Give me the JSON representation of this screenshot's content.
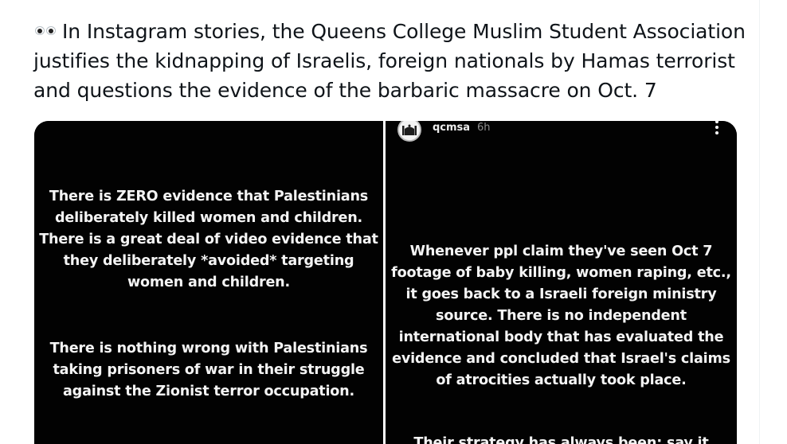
{
  "tweet": {
    "emoji": "eyes-emoji",
    "line1": "In Instagram stories, the Queens College Muslim Student Association",
    "line2": "justifies the kidnapping of Israelis, foreign nationals by Hamas terrorist",
    "line3": "and questions the evidence of the barbaric massacre on Oct. 7"
  },
  "left_story": {
    "paragraph1": "There is ZERO evidence that Palestinians deliberately killed women and children. There is a great deal of video evidence that they deliberately *avoided* targeting women and children.",
    "paragraph2": "There is nothing wrong with Palestinians taking prisoners of war in their struggle against the Zionist terror occupation."
  },
  "right_story": {
    "username": "qcmsa",
    "time": "6h",
    "avatar_icon": "mosque-avatar-icon",
    "more_icon": "more-vertical-icon",
    "paragraph1": "Whenever ppl claim they've seen Oct 7 footage of baby killing, women raping, etc., it goes back to a Israeli foreign ministry source. There is no independent international body that has evaluated the evidence and concluded that Israel's claims of atrocities actually took place.",
    "paragraph2_partial": "Their strategy has always been: say it"
  },
  "colors": {
    "tweet_text": "#0f1419",
    "story_bg": "#020202",
    "story_text": "#f4f4f4",
    "story_time": "#8e8e8e"
  }
}
